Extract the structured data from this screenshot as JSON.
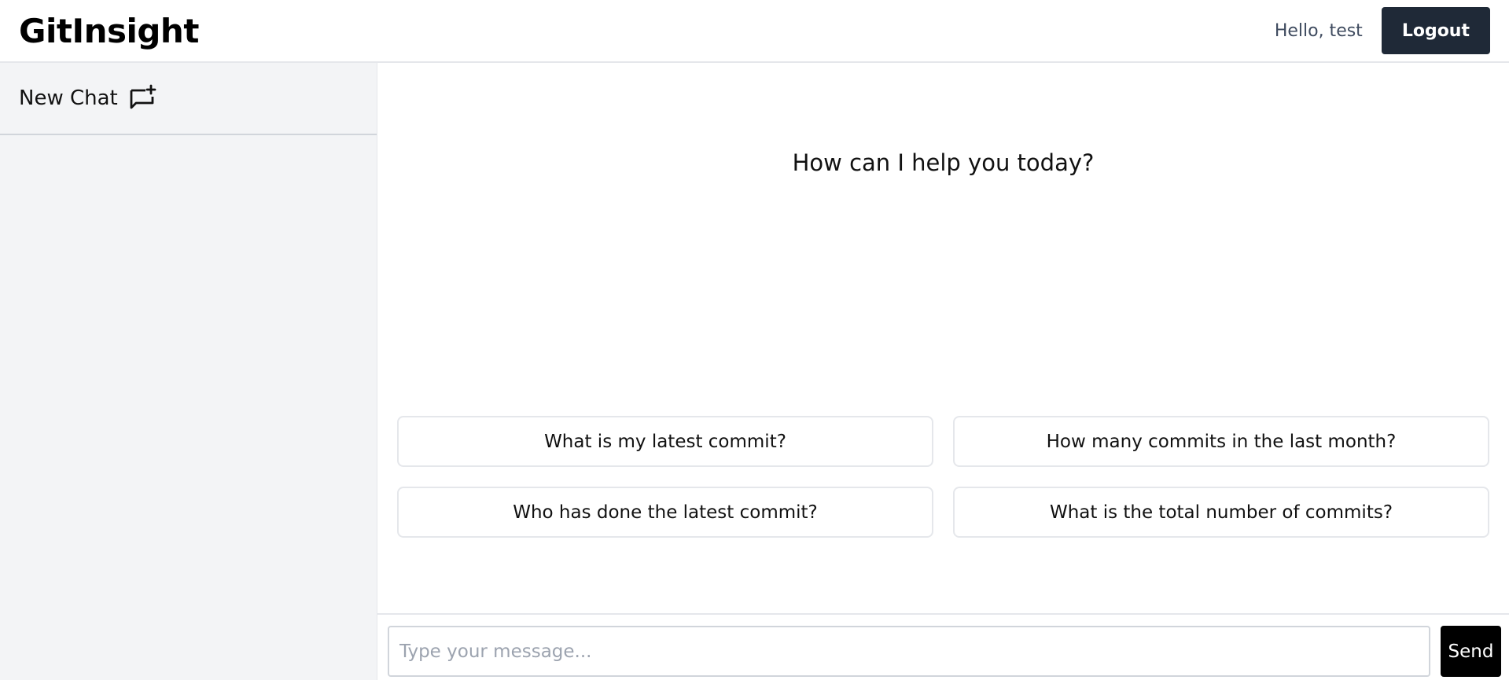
{
  "header": {
    "brand": "GitInsight",
    "greeting": "Hello, test",
    "logout_label": "Logout"
  },
  "sidebar": {
    "new_chat_label": "New Chat",
    "new_chat_icon": "new-chat-icon"
  },
  "main": {
    "welcome": "How can I help you today?",
    "suggestions": [
      "What is my latest commit?",
      "How many commits in the last month?",
      "Who has done the latest commit?",
      "What is the total number of commits?"
    ]
  },
  "composer": {
    "placeholder": "Type your message...",
    "value": "",
    "send_label": "Send"
  },
  "colors": {
    "logout_bg": "#1f2937",
    "sidebar_bg": "#f3f4f6",
    "send_bg": "#000000"
  }
}
